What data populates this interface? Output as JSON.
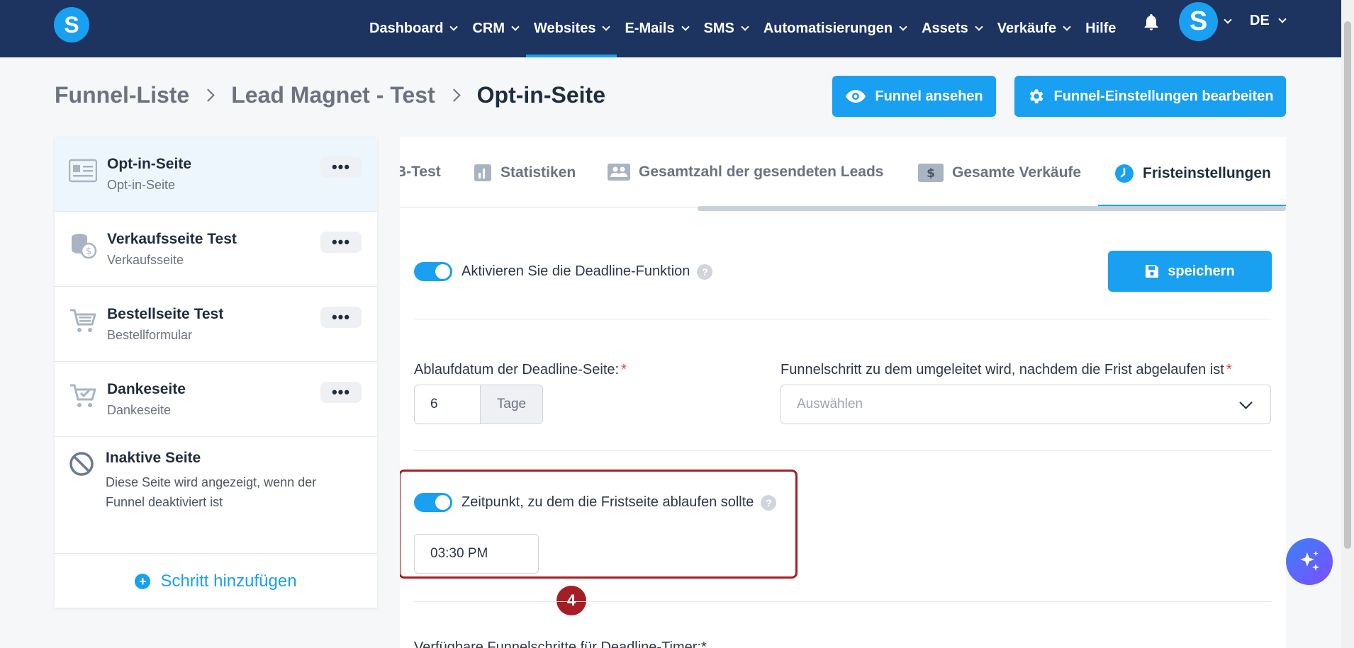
{
  "nav": {
    "logo": "S",
    "items": [
      {
        "label": "Dashboard"
      },
      {
        "label": "CRM"
      },
      {
        "label": "Websites"
      },
      {
        "label": "E-Mails"
      },
      {
        "label": "SMS"
      },
      {
        "label": "Automatisierungen"
      },
      {
        "label": "Assets"
      },
      {
        "label": "Verkäufe"
      },
      {
        "label": "Hilfe"
      }
    ],
    "avatar": "S",
    "language": "DE"
  },
  "breadcrumb": {
    "items": [
      "Funnel-Liste",
      "Lead Magnet - Test"
    ],
    "current": "Opt-in-Seite"
  },
  "header_buttons": {
    "view": "Funnel ansehen",
    "settings": "Funnel-Einstellungen bearbeiten"
  },
  "sidebar": {
    "steps": [
      {
        "title": "Opt-in-Seite",
        "subtitle": "Opt-in-Seite",
        "more": "•••"
      },
      {
        "title": "Verkaufsseite Test",
        "subtitle": "Verkaufsseite",
        "more": "•••"
      },
      {
        "title": "Bestellseite Test",
        "subtitle": "Bestellformular",
        "more": "•••"
      },
      {
        "title": "Dankeseite",
        "subtitle": "Dankeseite",
        "more": "•••"
      }
    ],
    "inactive": {
      "title": "Inaktive Seite",
      "description": "Diese Seite wird angezeigt, wenn der Funnel deaktiviert ist"
    },
    "add_step": "Schritt hinzufügen"
  },
  "tabs": [
    {
      "label": "B-Test"
    },
    {
      "label": "Statistiken"
    },
    {
      "label": "Gesamtzahl der gesendeten Leads"
    },
    {
      "label": "Gesamte Verkäufe"
    },
    {
      "label": "Fristeinstellungen"
    }
  ],
  "deadline": {
    "enable_label": "Aktivieren Sie die Deadline-Funktion",
    "enabled": true,
    "save_label": "speichern",
    "expiry_label": "Ablaufdatum der Deadline-Seite:",
    "expiry_value": "6",
    "expiry_unit": "Tage",
    "redirect_label": "Funnelschritt zu dem umgeleitet wird, nachdem die Frist abgelaufen ist",
    "redirect_placeholder": "Auswählen",
    "time_label": "Zeitpunkt, zu dem die Fristseite ablaufen sollte",
    "time_enabled": true,
    "time_value": "03:30 PM",
    "help": "?",
    "required_mark": "*",
    "next_label_partial": "Verfügbare Funnelschritte für Deadline-Timer:*"
  },
  "annotation": {
    "badge": "4",
    "color": "#a61e25"
  },
  "colors": {
    "nav_bg": "#1d3461",
    "accent": "#19a0f0"
  }
}
